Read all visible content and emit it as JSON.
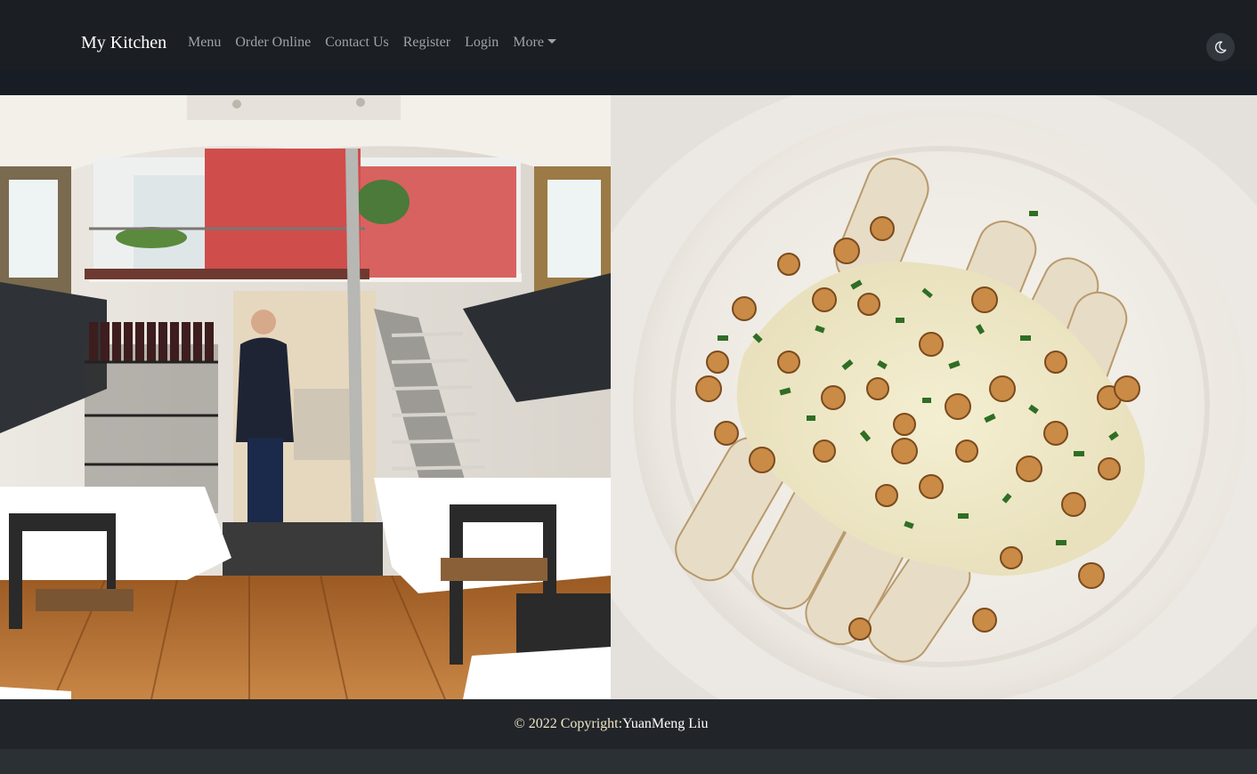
{
  "navbar": {
    "brand": "My Kitchen",
    "links": [
      "Menu",
      "Order Online",
      "Contact Us",
      "Register",
      "Login"
    ],
    "more_label": "More",
    "theme_toggle_icon": "moon-icon"
  },
  "hero": {
    "left_image": "restaurant-interior-photo",
    "right_image": "roasted-salsify-dish-photo"
  },
  "footer": {
    "copyright": "© 2022 Copyright:",
    "author": "YuanMeng Liu"
  },
  "colors": {
    "navbar_bg": "#1b1e23",
    "band_bg": "#171c25",
    "footer_bg": "#212529",
    "page_bg": "#2b3035",
    "nav_link": "#9ea3a8"
  }
}
